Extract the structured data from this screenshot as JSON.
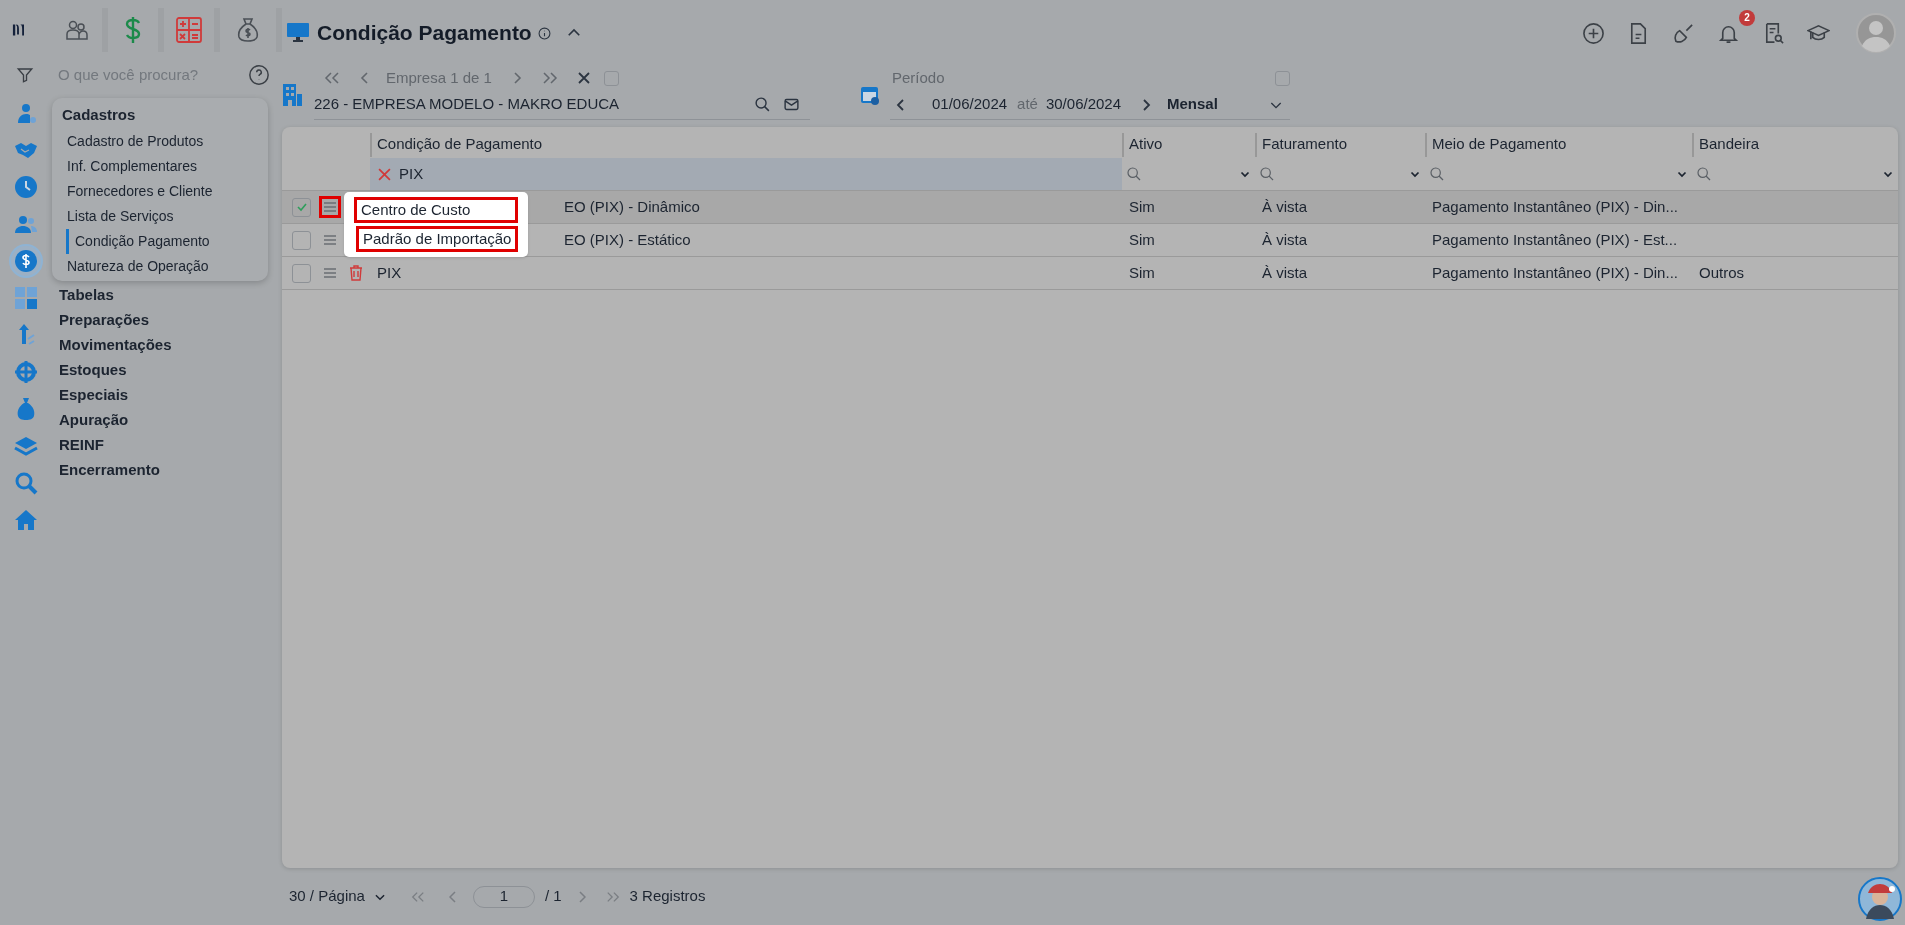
{
  "rail": [
    {
      "selected": false
    },
    {
      "selected": false
    },
    {
      "selected": false
    },
    {
      "selected": false
    },
    {
      "selected": true
    },
    {
      "selected": false
    },
    {
      "selected": false
    },
    {
      "selected": false
    },
    {
      "selected": false
    },
    {
      "selected": false
    },
    {
      "selected": false
    },
    {
      "selected": false
    }
  ],
  "search": {
    "placeholder": "O que você procura?"
  },
  "menu": [
    {
      "label": "Cadastros",
      "expanded": true,
      "children": [
        {
          "label": "Cadastro de Produtos",
          "selected": false
        },
        {
          "label": "Inf. Complementares",
          "selected": false
        },
        {
          "label": "Fornecedores e Cliente",
          "selected": false
        },
        {
          "label": "Lista de Serviços",
          "selected": false
        },
        {
          "label": "Condição Pagamento",
          "selected": true
        },
        {
          "label": "Natureza de Operação",
          "selected": false
        }
      ]
    },
    {
      "label": "Tabelas",
      "expanded": false
    },
    {
      "label": "Preparações",
      "expanded": false
    },
    {
      "label": "Movimentações",
      "expanded": false
    },
    {
      "label": "Estoques",
      "expanded": false
    },
    {
      "label": "Especiais",
      "expanded": false
    },
    {
      "label": "Apuração",
      "expanded": false
    },
    {
      "label": "REINF",
      "expanded": false
    },
    {
      "label": "Encerramento",
      "expanded": false
    }
  ],
  "page": {
    "title": "Condição Pagamento"
  },
  "notifications": {
    "badge": "2"
  },
  "company": {
    "pager": "Empresa 1 de 1",
    "all_checked": false,
    "value": "226 - EMPRESA MODELO - MAKRO EDUCA"
  },
  "period": {
    "label": "Período",
    "checked": false,
    "start": "01/06/2024",
    "separator": "até",
    "end": "30/06/2024",
    "mode": "Mensal"
  },
  "table": {
    "columns": [
      {
        "label": "Condição de Pagamento",
        "filter": "PIX"
      },
      {
        "label": "Ativo"
      },
      {
        "label": "Faturamento"
      },
      {
        "label": "Meio de Pagamento"
      },
      {
        "label": "Bandeira"
      }
    ],
    "rows": [
      {
        "checked": true,
        "selected": true,
        "menu_highlighted": true,
        "cells": [
          "EO (PIX) - Dinâmico",
          "Sim",
          "À vista",
          "Pagamento Instantâneo (PIX) - Din...",
          null
        ]
      },
      {
        "checked": false,
        "selected": false,
        "menu_highlighted": false,
        "cells": [
          "EO (PIX) - Estático",
          "Sim",
          "À vista",
          "Pagamento Instantâneo (PIX) - Est...",
          null
        ]
      },
      {
        "checked": false,
        "selected": false,
        "menu_highlighted": false,
        "trash": true,
        "cells": [
          "PIX",
          "Sim",
          "À vista",
          "Pagamento Instantâneo (PIX) - Din...",
          "Outros"
        ]
      }
    ]
  },
  "context_menu": {
    "items": [
      {
        "label": "Centro de Custo",
        "highlighted": true
      },
      {
        "label": "Padrão de Importação",
        "highlighted": true
      }
    ]
  },
  "footer": {
    "page_size": "30 / Página",
    "page": "1",
    "total_pages": "/ 1",
    "records": "3 Registros"
  }
}
